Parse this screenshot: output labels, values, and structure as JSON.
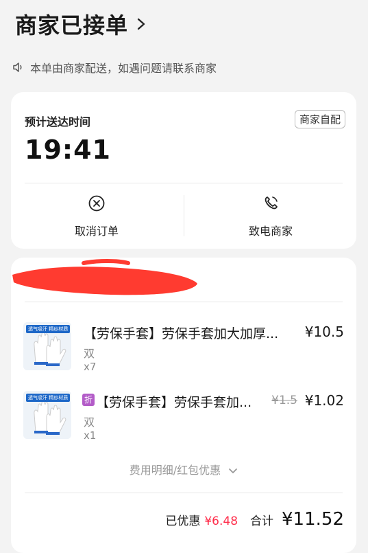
{
  "header": {
    "status_title": "商家已接单"
  },
  "notice": {
    "text": "本单由商家配送，如遇问题请联系商家"
  },
  "delivery": {
    "eta_label": "预计送达时间",
    "eta_time": "19:41",
    "merchant_badge": "商家自配",
    "cancel_label": "取消订单",
    "call_label": "致电商家"
  },
  "order": {
    "items": [
      {
        "thumb_tag": "透气吸汗 精纱材质",
        "name": "【劳保手套】劳保手套加大加厚...",
        "spec": "双",
        "qty": "x7",
        "price": "¥10.5"
      },
      {
        "thumb_tag": "透气吸汗 精纱材质",
        "discount_tag": "折",
        "name": "【劳保手套】劳保手套加...",
        "spec": "双",
        "qty": "x1",
        "original_price": "¥1.5",
        "price": "¥1.02"
      }
    ],
    "fee_detail_label": "费用明细/红包优惠",
    "discount_label": "已优惠",
    "discount_amount": "¥6.48",
    "total_label": "合计",
    "total_amount": "¥11.52"
  },
  "colors": {
    "accent_red": "#ff2d4b",
    "redaction_red": "#ff3b30",
    "discount_tag": "#b35cc8"
  }
}
